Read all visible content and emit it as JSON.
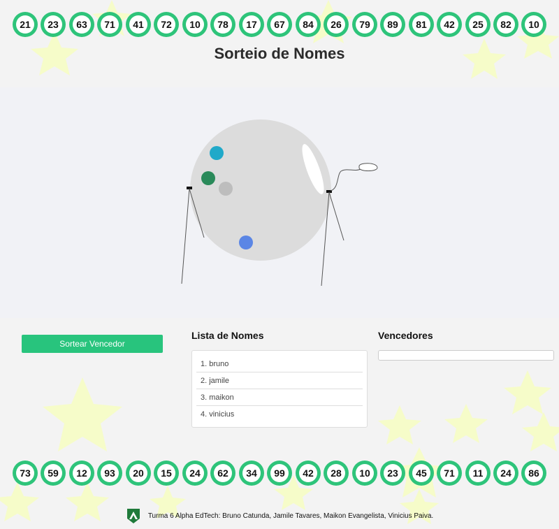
{
  "header": {
    "title": "Sorteio de Nomes",
    "top_balls": [
      "21",
      "23",
      "63",
      "71",
      "41",
      "72",
      "10",
      "78",
      "17",
      "67",
      "84",
      "26",
      "79",
      "89",
      "81",
      "42",
      "25",
      "82",
      "10"
    ]
  },
  "machine": {
    "ball_colors": [
      "#20a9c9",
      "#2a8a5a",
      "#bdbdbd",
      "#5b86e5"
    ]
  },
  "controls": {
    "draw_button_label": "Sortear Vencedor"
  },
  "names_list": {
    "title": "Lista de Nomes",
    "items": [
      "1. bruno",
      "2. jamile",
      "3. maikon",
      "4. vinicius"
    ]
  },
  "winners": {
    "title": "Vencedores"
  },
  "bottom_balls": [
    "73",
    "59",
    "12",
    "93",
    "20",
    "15",
    "24",
    "62",
    "34",
    "99",
    "42",
    "28",
    "10",
    "23",
    "45",
    "71",
    "11",
    "24",
    "86"
  ],
  "footer": {
    "credits": "Turma 6 Alpha EdTech: Bruno Catunda, Jamile Tavares, Maikon Evangelista, Vinicius Paiva."
  },
  "colors": {
    "accent": "#28c47d",
    "ball_ring": "#2ec47a",
    "star": "#f6fcc9"
  }
}
